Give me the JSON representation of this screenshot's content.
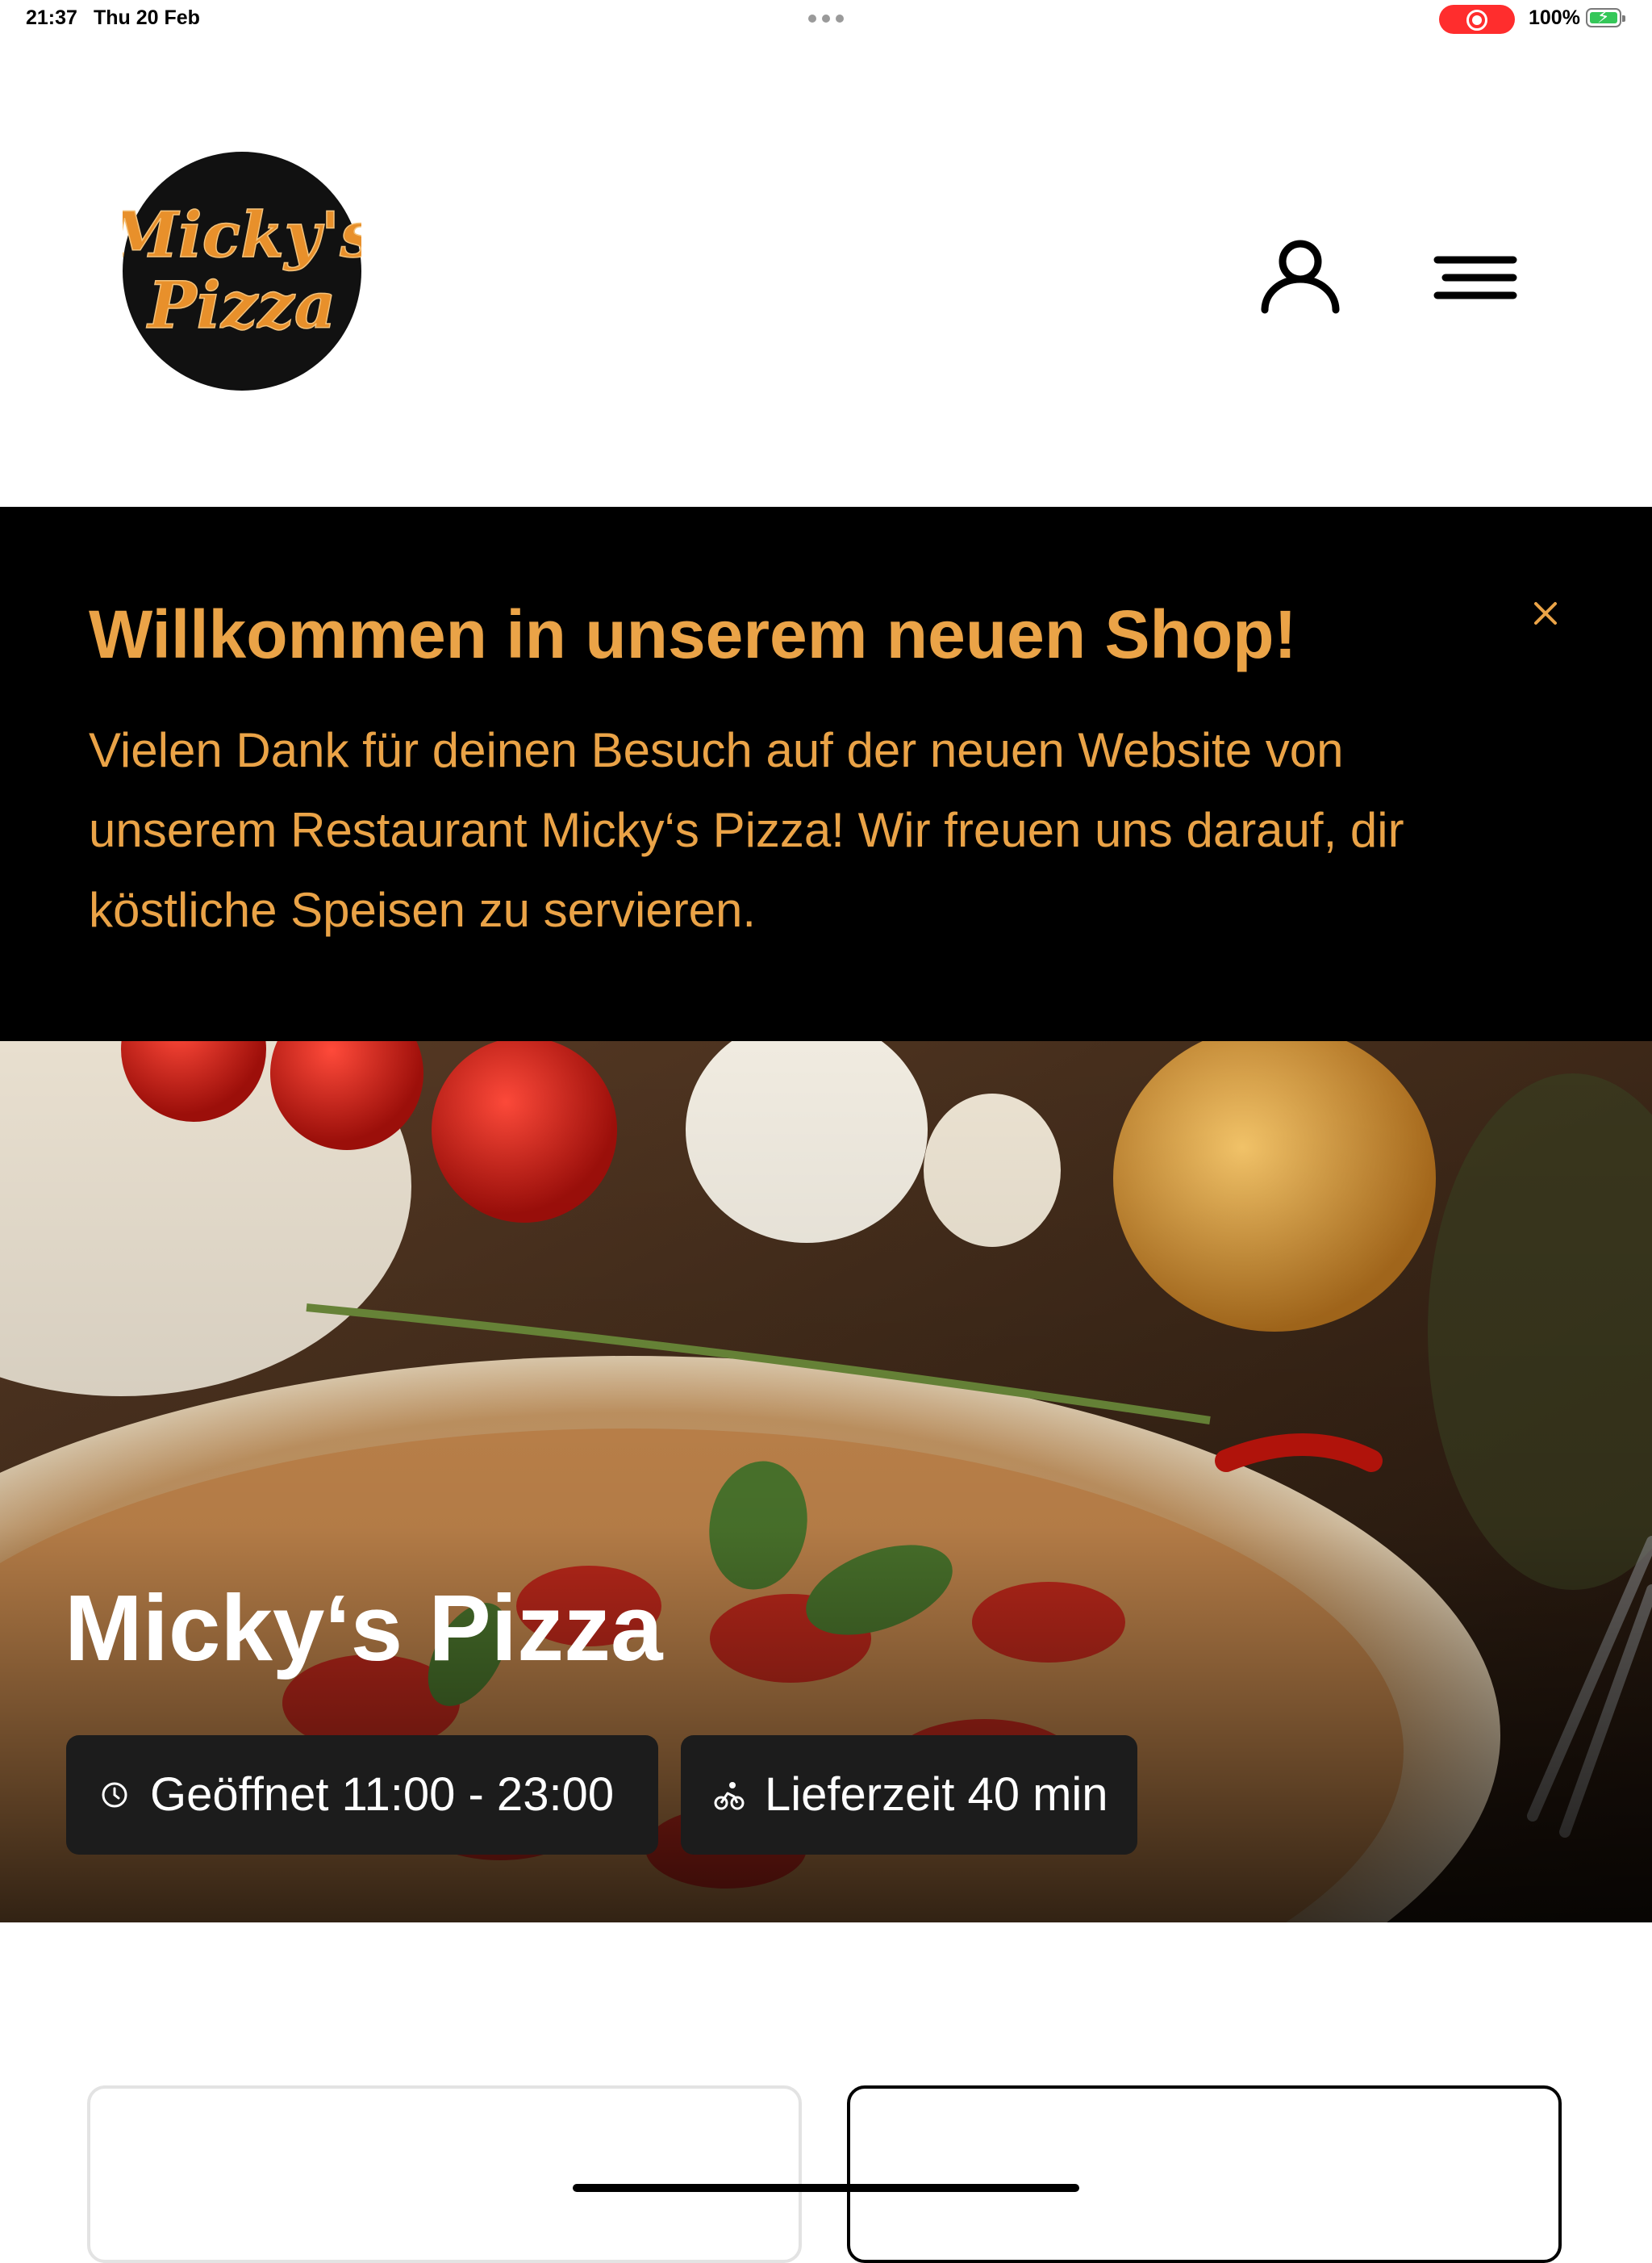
{
  "status_bar": {
    "time": "21:37",
    "date": "Thu 20 Feb",
    "battery": "100%",
    "icons": [
      "multitask-dots-icon",
      "screen-recording-icon",
      "battery-charging-icon"
    ]
  },
  "header": {
    "logo": {
      "line1": "Micky's",
      "line2": "Pizza"
    },
    "icons": [
      "user-icon",
      "menu-icon"
    ]
  },
  "banner": {
    "title": "Willkommen in unserem neuen Shop!",
    "text": "Vielen Dank für deinen Besuch auf der neuen Website von unserem Restaurant Micky‘s Pizza! Wir freuen uns darauf, dir köstliche Speisen zu servieren.",
    "close_icon": "close-icon"
  },
  "hero": {
    "title": "Micky‘s Pizza",
    "hours": "Geöffnet 11:00 - 23:00",
    "delivery": "Lieferzeit 40 min",
    "icons": [
      "clock-icon",
      "delivery-bike-icon"
    ]
  },
  "colors": {
    "accent": "#eaa347",
    "banner_bg": "#000000",
    "pill_bg": "#1c1c1c",
    "recording": "#ff2d2d",
    "battery": "#35c759"
  }
}
